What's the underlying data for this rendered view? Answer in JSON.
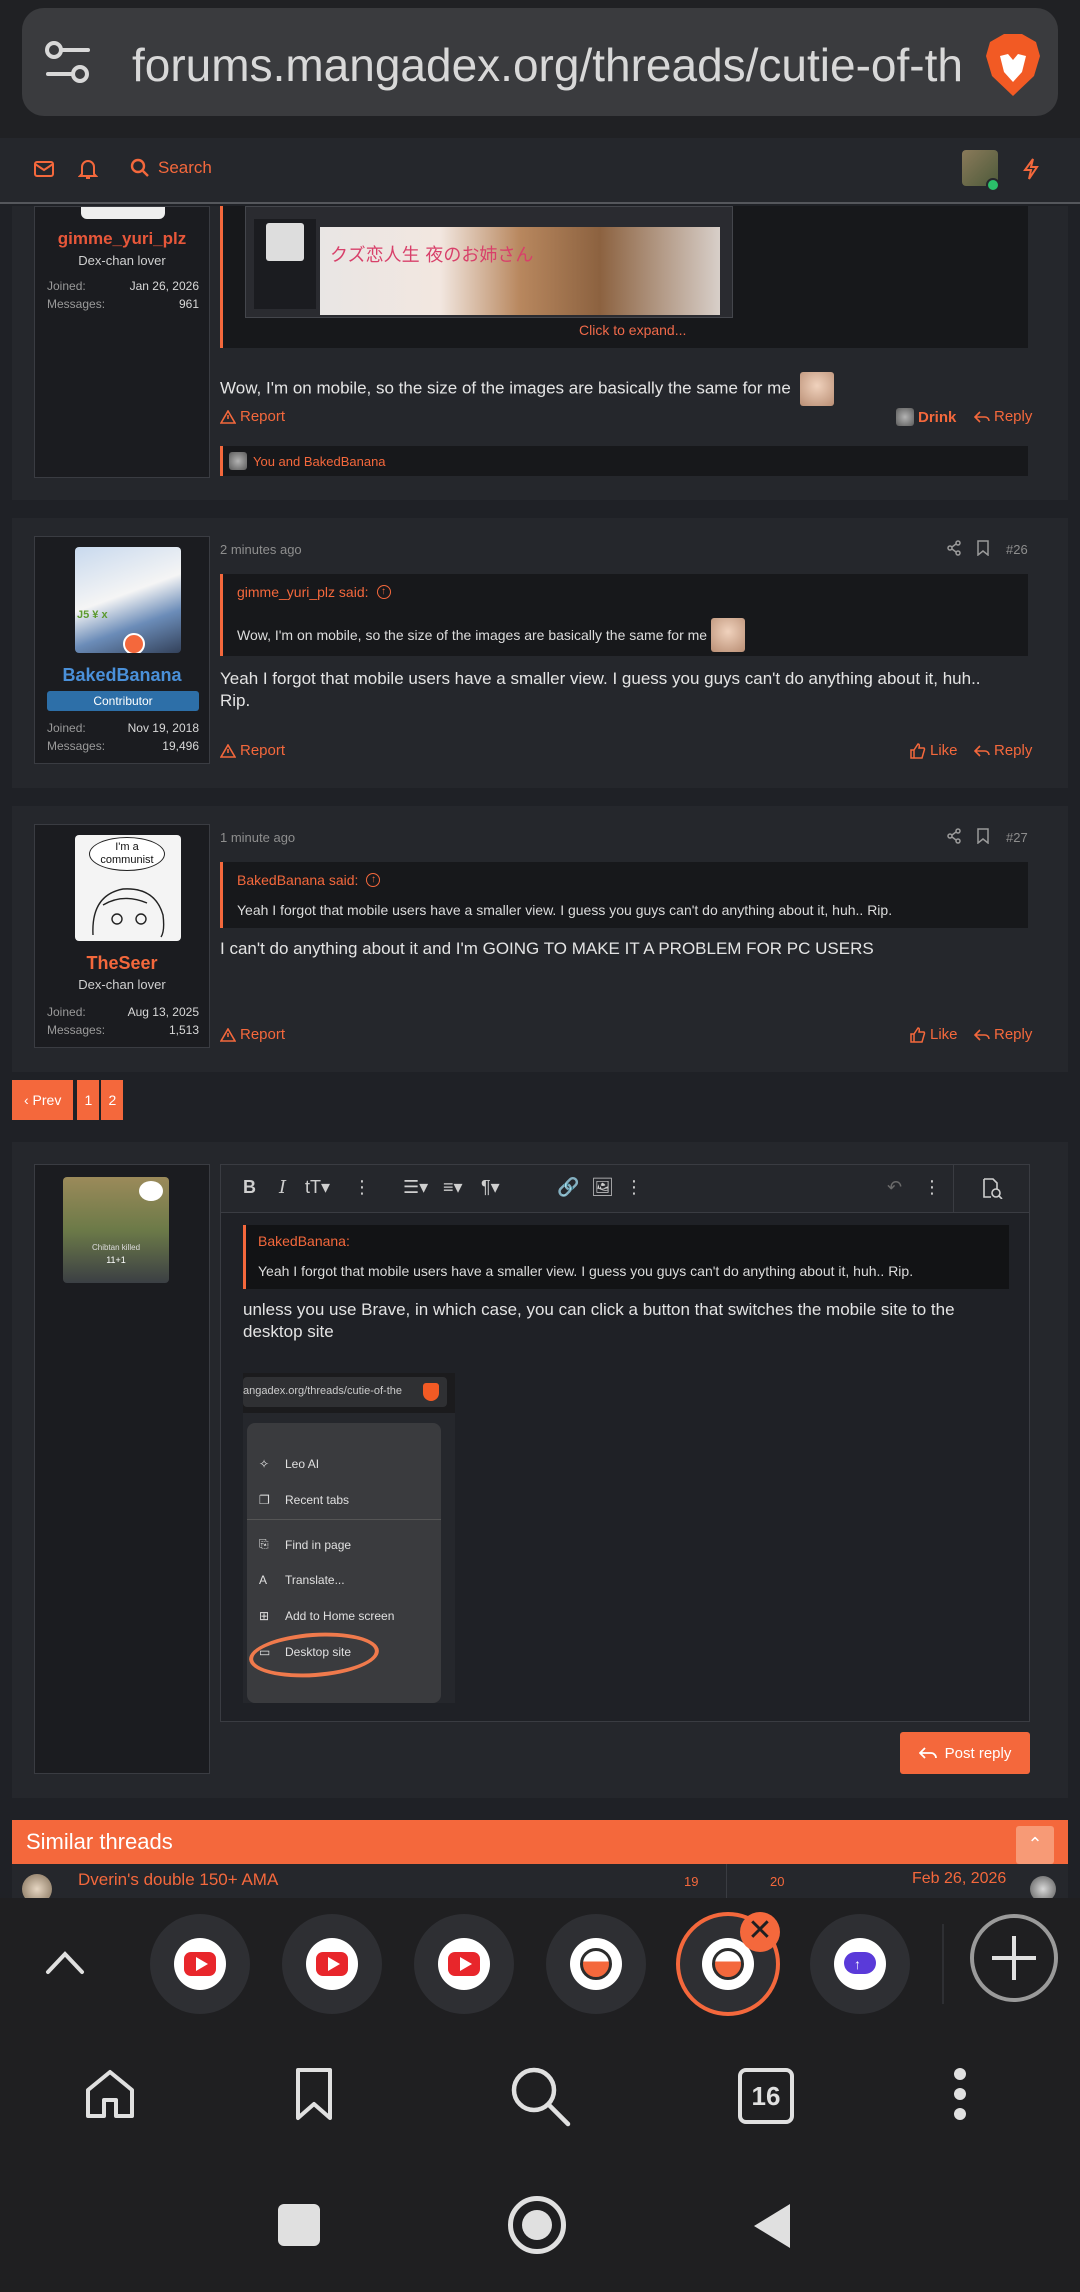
{
  "browser": {
    "url": "forums.mangadex.org/threads/cutie-of-the",
    "tab_count": "16"
  },
  "sitenav": {
    "search_label": "Search"
  },
  "post1": {
    "username": "gimme_yuri_plz",
    "user_title": "Dex-chan lover",
    "joined_label": "Joined:",
    "joined": "Jan 26, 2026",
    "messages_label": "Messages:",
    "messages": "961",
    "expand_label": "Click to expand...",
    "message": "Wow, I'm on mobile, so the size of the images are basically the same for me",
    "report": "Report",
    "drink": "Drink",
    "reply": "Reply",
    "reactions": "You and BakedBanana"
  },
  "post2": {
    "username": "BakedBanana",
    "badge": "Contributor",
    "joined_label": "Joined:",
    "joined": "Nov 19, 2018",
    "messages_label": "Messages:",
    "messages": "19,496",
    "time": "2 minutes ago",
    "number": "#26",
    "quote_author": "gimme_yuri_plz said:",
    "quote_text": "Wow, I'm on mobile, so the size of the images are basically the same for me",
    "message_line1": "Yeah I forgot that mobile users have a smaller view. I guess you guys can't do anything about it, huh..",
    "message_line2": "Rip.",
    "report": "Report",
    "like": "Like",
    "reply": "Reply"
  },
  "post3": {
    "username": "TheSeer",
    "user_title": "Dex-chan lover",
    "joined_label": "Joined:",
    "joined": "Aug 13, 2025",
    "messages_label": "Messages:",
    "messages": "1,513",
    "avatar_text_1": "I'm a",
    "avatar_text_2": "communist",
    "time": "1 minute ago",
    "number": "#27",
    "quote_author": "BakedBanana said:",
    "quote_text": "Yeah I forgot that mobile users have a smaller view. I guess you guys can't do anything about it, huh.. Rip.",
    "message": "I can't do anything about it and I'm GOING TO MAKE IT A PROBLEM FOR PC USERS",
    "report": "Report",
    "like": "Like",
    "reply": "Reply"
  },
  "pagination": {
    "prev": "‹ Prev",
    "pages": [
      "1",
      "2"
    ]
  },
  "editor": {
    "quote_author": "BakedBanana:",
    "quote_text": "Yeah I forgot that mobile users have a smaller view. I guess you guys can't do anything about it, huh.. Rip.",
    "draft_line1": "unless you use Brave, in which case, you can click a button that switches the mobile site to the",
    "draft_line2": "desktop site",
    "post_reply": "Post reply",
    "user_caption_1": "Chibtan killed",
    "user_caption_2": "11+1",
    "screenshot": {
      "url": "angadex.org/threads/cutie-of-the",
      "menu": [
        "Leo AI",
        "Recent tabs",
        "Find in page",
        "Translate...",
        "Add to Home screen",
        "Desktop site"
      ]
    }
  },
  "similar": {
    "title": "Similar threads",
    "thread_title": "Dverin's double 150+ AMA",
    "replies": "19",
    "views": "20",
    "date": "Feb 26, 2026"
  },
  "colors": {
    "accent": "#f4683c",
    "blue": "#4a90d9",
    "badge": "#2d6fa8"
  }
}
